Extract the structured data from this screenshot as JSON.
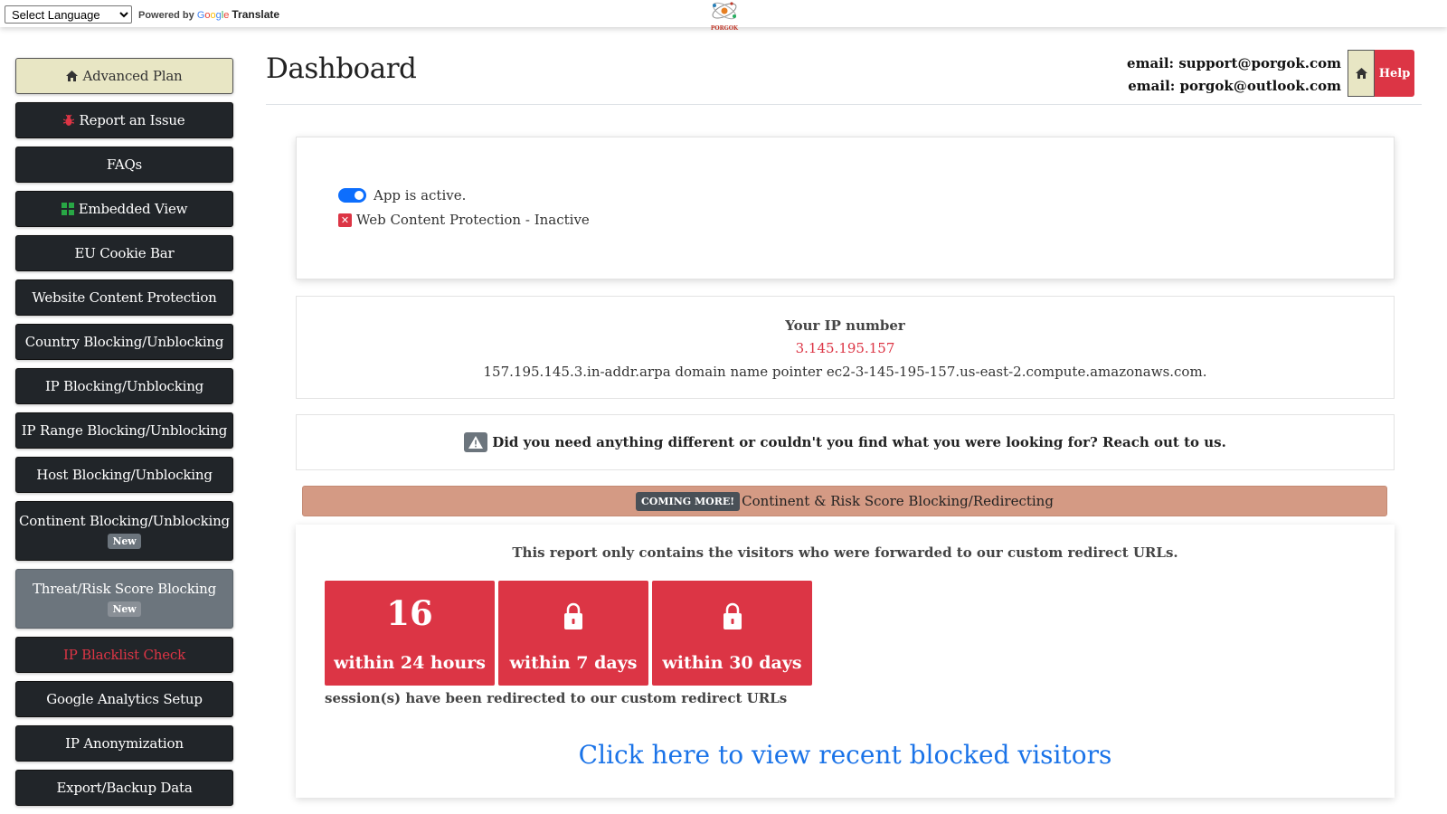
{
  "translate": {
    "select_label": "Select Language",
    "powered_by": "Powered by",
    "google": "Google",
    "translate": "Translate"
  },
  "logo": {
    "text": "PORGOK"
  },
  "sidebar": {
    "items": [
      {
        "label": "Advanced Plan",
        "icon": "home-icon"
      },
      {
        "label": "Report an Issue",
        "icon": "bug-icon"
      },
      {
        "label": "FAQs"
      },
      {
        "label": "Embedded View",
        "icon": "grid-icon"
      },
      {
        "label": "EU Cookie Bar"
      },
      {
        "label": "Website Content Protection"
      },
      {
        "label": "Country Blocking/Unblocking"
      },
      {
        "label": "IP Blocking/Unblocking"
      },
      {
        "label": "IP Range Blocking/Unblocking"
      },
      {
        "label": "Host Blocking/Unblocking"
      },
      {
        "label": "Continent Blocking/Unblocking",
        "badge": "New"
      },
      {
        "label": "Threat/Risk Score Blocking",
        "badge": "New"
      },
      {
        "label": "IP Blacklist Check"
      },
      {
        "label": "Google Analytics Setup"
      },
      {
        "label": "IP Anonymization"
      },
      {
        "label": "Export/Backup Data"
      }
    ]
  },
  "header": {
    "title": "Dashboard",
    "email1": "email: support@porgok.com",
    "email2": "email: porgok@outlook.com",
    "help_label": "Help"
  },
  "status": {
    "app_active": "App is active.",
    "web_protection": "Web Content Protection - Inactive"
  },
  "ip": {
    "label": "Your IP number",
    "value": "3.145.195.157",
    "pointer": "157.195.145.3.in-addr.arpa domain name pointer ec2-3-145-195-157.us-east-2.compute.amazonaws.com."
  },
  "reach_out": "Did you need anything different or couldn't you find what you were looking for? Reach out to us.",
  "coming": {
    "badge": "COMING MORE!",
    "text": "Continent & Risk Score Blocking/Redirecting"
  },
  "report": {
    "text": "This report only contains the visitors who were forwarded to our custom redirect URLs.",
    "stats": [
      {
        "value": "16",
        "label": "within 24 hours"
      },
      {
        "label": "within 7 days",
        "icon": "lock-icon"
      },
      {
        "label": "within 30 days",
        "icon": "lock-icon"
      }
    ],
    "sessions_text": "session(s) have been redirected to our custom redirect URLs",
    "link": "Click here to view recent blocked visitors"
  },
  "colors": {
    "dark": "#212529",
    "danger": "#dc3545",
    "primary": "#0d6efd",
    "link": "#1a73e8",
    "coming_bar": "#d49a84",
    "plan_button": "#e8e6c4"
  }
}
